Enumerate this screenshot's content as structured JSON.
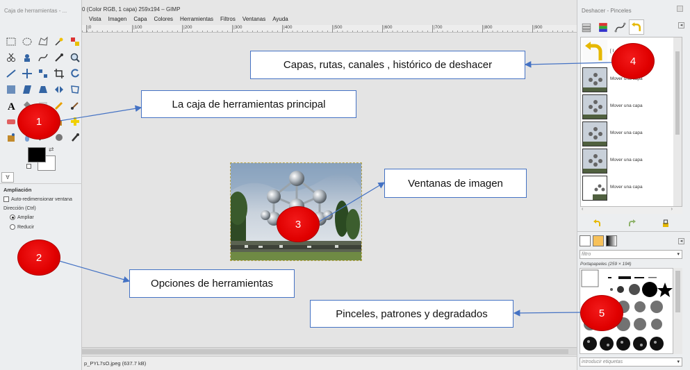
{
  "toolbox": {
    "title": "Caja de herramientas - ...",
    "tools": [
      "rect-select-icon",
      "ellipse-select-icon",
      "free-select-icon",
      "fuzzy-select-icon",
      "color-select-icon",
      "scissors-icon",
      "foreground-select-icon",
      "paths-icon",
      "color-picker-icon",
      "zoom-icon",
      "measure-icon",
      "move-icon",
      "align-icon",
      "crop-icon",
      "rotate-icon",
      "scale-icon",
      "shear-icon",
      "perspective-icon",
      "flip-icon",
      "cage-icon",
      "text-icon",
      "bucket-fill-icon",
      "gradient-icon",
      "pencil-icon",
      "paintbrush-icon",
      "eraser-icon",
      "airbrush-icon",
      "ink-icon",
      "clone-icon",
      "heal-icon",
      "perspective-clone-icon",
      "blur-icon",
      "smudge-icon",
      "dodge-icon",
      "mypaint-brush-icon"
    ],
    "colors": {
      "foreground": "#000000",
      "background": "#ffffff"
    },
    "tool_options": {
      "tab_label": "∀",
      "title": "Ampliación",
      "auto_resize_label": "Auto-redimensionar ventana",
      "direction_label": "Dirección (Ctrl)",
      "zoom_in_label": "Ampliar",
      "zoom_out_label": "Reducir"
    }
  },
  "image_window": {
    "title": "0 (Color RGB, 1 capa) 259x194 – GIMP",
    "menus": [
      "Vista",
      "Imagen",
      "Capa",
      "Colores",
      "Herramientas",
      "Filtros",
      "Ventanas",
      "Ayuda"
    ],
    "ruler_marks": [
      "|0",
      "|100",
      "|200",
      "|300",
      "|400",
      "|500",
      "|600",
      "|700",
      "|800",
      "|900"
    ],
    "status": "p_PYL7sO.jpeg (637.7 kB)"
  },
  "dock": {
    "title": "Deshacer - Pinceles",
    "menu_glyph": "◂",
    "undo_items": [
      {
        "label": "[ I"
      },
      {
        "label": "Mover una capa"
      },
      {
        "label": "Mover una capa"
      },
      {
        "label": "Mover una capa"
      },
      {
        "label": "Mover una capa"
      },
      {
        "label": "Mover una capa"
      }
    ],
    "scroll_left": "‹",
    "scroll_right": "›",
    "filter_placeholder": "filtro",
    "dropdown_glyph": "▾",
    "brush_label": "Portapapeles (259 × 194)",
    "tag_placeholder": "introducir etiquetas"
  },
  "annotations": [
    {
      "number": "1",
      "text": "La caja de herramientas principal"
    },
    {
      "number": "2",
      "text": "Opciones de herramientas"
    },
    {
      "number": "3",
      "text": "Ventanas de imagen"
    },
    {
      "number": "4",
      "text": "Capas, rutas, canales , histórico de deshacer"
    },
    {
      "number": "5",
      "text": "Pinceles, patrones y degradados"
    }
  ],
  "annotation_color": "#4472c4",
  "marker_color": "#e00000"
}
